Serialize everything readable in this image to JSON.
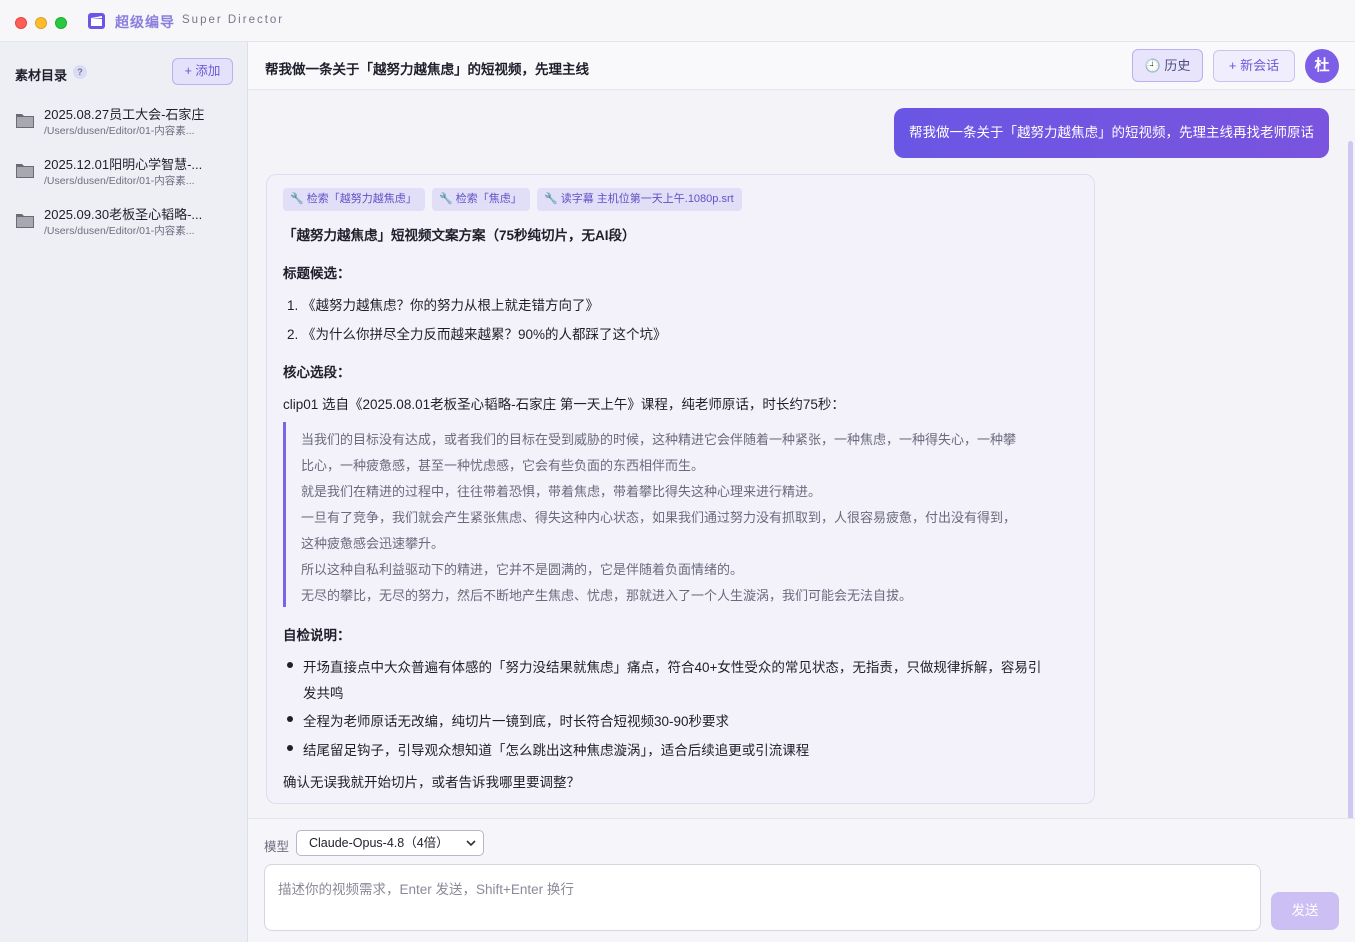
{
  "app": {
    "title": "超级编导",
    "subtitle": "Super Director"
  },
  "sidebar": {
    "title": "素材目录",
    "help": "?",
    "add_label": "+ 添加",
    "items": [
      {
        "name": "2025.08.27员工大会-石家庄",
        "path": "/Users/dusen/Editor/01-内容素..."
      },
      {
        "name": "2025.12.01阳明心学智慧-...",
        "path": "/Users/dusen/Editor/01-内容素..."
      },
      {
        "name": "2025.09.30老板圣心韬略-...",
        "path": "/Users/dusen/Editor/01-内容素..."
      }
    ]
  },
  "header": {
    "title": "帮我做一条关于「越努力越焦虑」的短视频，先理主线",
    "history_label": "🕘 历史",
    "new_chat_label": "+ 新会话",
    "avatar": "杜"
  },
  "chat": {
    "user_message": "帮我做一条关于「越努力越焦虑」的短视频，先理主线再找老师原话",
    "tools": [
      "检索「越努力越焦虑」",
      "检索「焦虑」",
      "读字幕 主机位第一天上午.1080p.srt"
    ],
    "doc_title": "「越努力越焦虑」短视频文案方案（75秒纯切片，无AI段）",
    "titles_heading": "标题候选：",
    "titles": [
      "1.  《越努力越焦虑？你的努力从根上就走错方向了》",
      "2.  《为什么你拼尽全力反而越来越累？90%的人都踩了这个坑》"
    ],
    "core_heading": "核心选段：",
    "clip_intro": "clip01 选自《2025.08.01老板圣心韬略-石家庄 第一天上午》课程，纯老师原话，时长约75秒：",
    "quote_lines": [
      "当我们的目标没有达成，或者我们的目标在受到威胁的时候，这种精进它会伴随着一种紧张，一种焦虑，一种得失心，一种攀",
      "比心，一种疲惫感，甚至一种忧虑感，它会有些负面的东西相伴而生。",
      "就是我们在精进的过程中，往往带着恐惧，带着焦虑，带着攀比得失这种心理来进行精进。",
      "一旦有了竞争，我们就会产生紧张焦虑、得失这种内心状态，如果我们通过努力没有抓取到，人很容易疲惫，付出没有得到，",
      "这种疲惫感会迅速攀升。",
      "所以这种自私利益驱动下的精进，它并不是圆满的，它是伴随着负面情绪的。",
      "无尽的攀比，无尽的努力，然后不断地产生焦虑、忧虑，那就进入了一个人生漩涡，我们可能会无法自拔。"
    ],
    "check_heading": "自检说明：",
    "check_items": [
      "开场直接点中大众普遍有体感的「努力没结果就焦虑」痛点，符合40+女性受众的常见状态，无指责，只做规律拆解，容易引",
      "发共鸣",
      "全程为老师原话无改编，纯切片一镜到底，时长符合短视频30-90秒要求",
      "结尾留足钩子，引导观众想知道「怎么跳出这种焦虑漩涡」，适合后续追更或引流课程"
    ],
    "closing": "确认无误我就开始切片，或者告诉我哪里要调整？"
  },
  "composer": {
    "model_label": "模型",
    "model_value": "Claude-Opus-4.8（4倍）",
    "input_placeholder": "描述你的视频需求，Enter 发送，Shift+Enter 换行",
    "send_label": "发送"
  },
  "colors": {
    "accent": "#6d55e8",
    "bubble": "#6f55e0",
    "quote_bar": "#7b65e3"
  }
}
